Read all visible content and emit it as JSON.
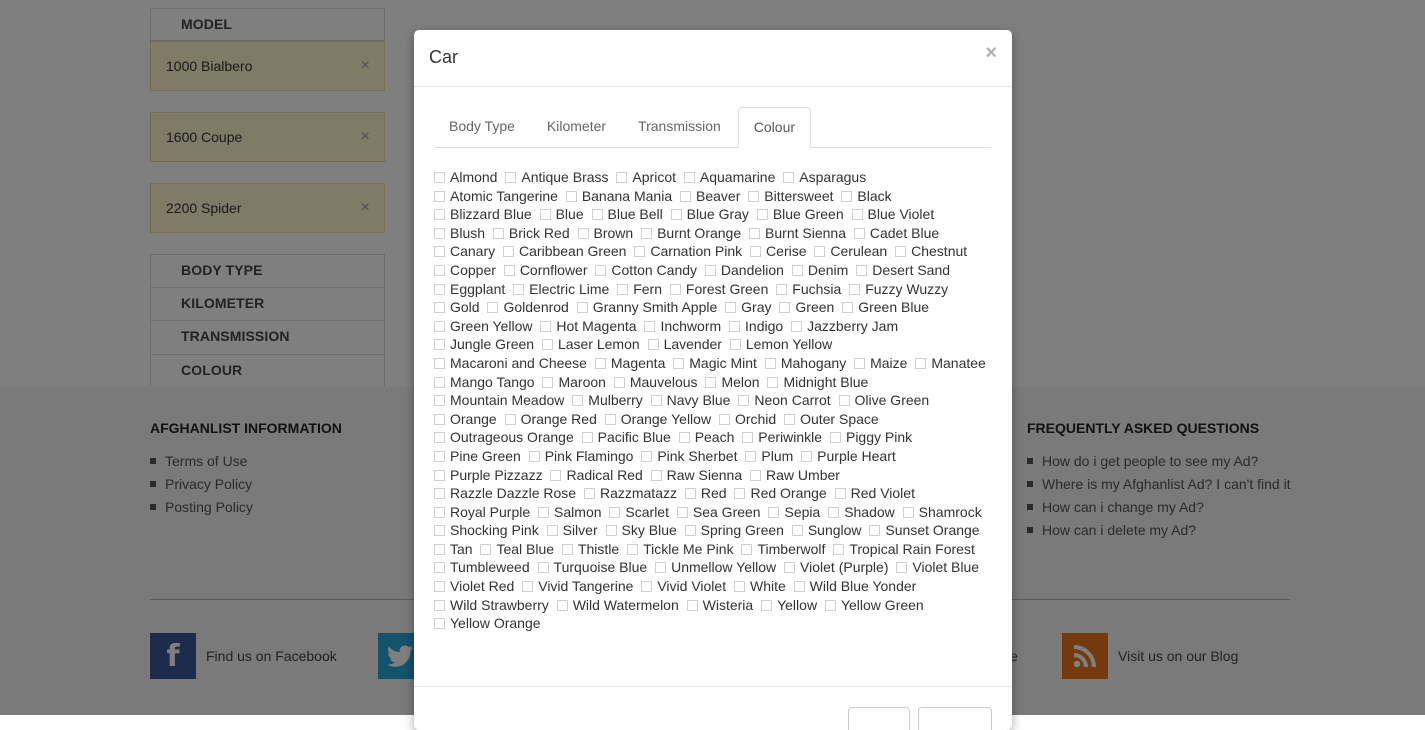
{
  "filters": {
    "model_heading": "MODEL",
    "selected_models": [
      "1000 Bialbero",
      "1600 Coupe",
      "2200 Spider"
    ],
    "remove_symbol": "×",
    "sections": [
      "BODY TYPE",
      "KILOMETER",
      "TRANSMISSION",
      "COLOUR"
    ]
  },
  "footer": {
    "info": {
      "title": "AFGHANLIST INFORMATION",
      "links": [
        "Terms of Use",
        "Privacy Policy",
        "Posting Policy"
      ]
    },
    "faq": {
      "title": "FREQUENTLY ASKED QUESTIONS",
      "links": [
        "How do i get people to see my Ad?",
        "Where is my Afghanlist Ad? I can't find it",
        "How can i change my Ad?",
        "How can i delete my Ad?"
      ]
    },
    "social": {
      "facebook": "Find us on Facebook",
      "blog": "Visit us on our Blog",
      "partial_text": "e"
    },
    "colors": {
      "facebook": "#3b5998",
      "twitter": "#2ba4d9",
      "blog": "#e8741c"
    }
  },
  "modal": {
    "title": "Car",
    "close": "×",
    "tabs": [
      "Body Type",
      "Kilometer",
      "Transmission",
      "Colour"
    ],
    "active_tab": "Colour",
    "colours": [
      "Almond",
      "Antique Brass",
      "Apricot",
      "Aquamarine",
      "Asparagus",
      "Atomic Tangerine",
      "Banana Mania",
      "Beaver",
      "Bittersweet",
      "Black",
      "Blizzard Blue",
      "Blue",
      "Blue Bell",
      "Blue Gray",
      "Blue Green",
      "Blue Violet",
      "Blush",
      "Brick Red",
      "Brown",
      "Burnt Orange",
      "Burnt Sienna",
      "Cadet Blue",
      "Canary",
      "Caribbean Green",
      "Carnation Pink",
      "Cerise",
      "Cerulean",
      "Chestnut",
      "Copper",
      "Cornflower",
      "Cotton Candy",
      "Dandelion",
      "Denim",
      "Desert Sand",
      "Eggplant",
      "Electric Lime",
      "Fern",
      "Forest Green",
      "Fuchsia",
      "Fuzzy Wuzzy",
      "Gold",
      "Goldenrod",
      "Granny Smith Apple",
      "Gray",
      "Green",
      "Green Blue",
      "Green Yellow",
      "Hot Magenta",
      "Inchworm",
      "Indigo",
      "Jazzberry Jam",
      "Jungle Green",
      "Laser Lemon",
      "Lavender",
      "Lemon Yellow",
      "Macaroni and Cheese",
      "Magenta",
      "Magic Mint",
      "Mahogany",
      "Maize",
      "Manatee",
      "Mango Tango",
      "Maroon",
      "Mauvelous",
      "Melon",
      "Midnight Blue",
      "Mountain Meadow",
      "Mulberry",
      "Navy Blue",
      "Neon Carrot",
      "Olive Green",
      "Orange",
      "Orange Red",
      "Orange Yellow",
      "Orchid",
      "Outer Space",
      "Outrageous Orange",
      "Pacific Blue",
      "Peach",
      "Periwinkle",
      "Piggy Pink",
      "Pine Green",
      "Pink Flamingo",
      "Pink Sherbet",
      "Plum",
      "Purple Heart",
      "Purple Pizzazz",
      "Radical Red",
      "Raw Sienna",
      "Raw Umber",
      "Razzle Dazzle Rose",
      "Razzmatazz",
      "Red",
      "Red Orange",
      "Red Violet",
      "Royal Purple",
      "Salmon",
      "Scarlet",
      "Sea Green",
      "Sepia",
      "Shadow",
      "Shamrock",
      "Shocking Pink",
      "Silver",
      "Sky Blue",
      "Spring Green",
      "Sunglow",
      "Sunset Orange",
      "Tan",
      "Teal Blue",
      "Thistle",
      "Tickle Me Pink",
      "Timberwolf",
      "Tropical Rain Forest",
      "Tumbleweed",
      "Turquoise Blue",
      "Unmellow Yellow",
      "Violet (Purple)",
      "Violet Blue",
      "Violet Red",
      "Vivid Tangerine",
      "Vivid Violet",
      "White",
      "Wild Blue Yonder",
      "Wild Strawberry",
      "Wild Watermelon",
      "Wisteria",
      "Yellow",
      "Yellow Green",
      "Yellow Orange"
    ]
  }
}
